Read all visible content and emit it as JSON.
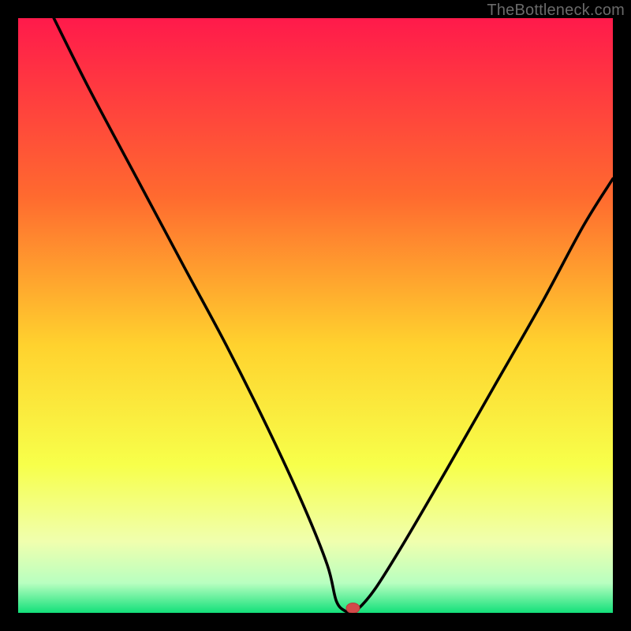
{
  "watermark": "TheBottleneck.com",
  "chart_data": {
    "type": "line",
    "title": "",
    "xlabel": "",
    "ylabel": "",
    "xlim": [
      0,
      100
    ],
    "ylim": [
      0,
      100
    ],
    "x": [
      6,
      12,
      20,
      28,
      35,
      42,
      48,
      52,
      53.5,
      55,
      56,
      57,
      60,
      65,
      72,
      80,
      88,
      95,
      100
    ],
    "values": [
      100,
      88,
      73,
      58,
      45,
      31,
      18,
      8,
      2,
      0.3,
      0.3,
      0.5,
      4,
      12,
      24,
      38,
      52,
      65,
      73
    ],
    "marker": {
      "x": 56.3,
      "y": 0.8,
      "color": "#d24a4a"
    },
    "gradient_stops": [
      {
        "offset": 0,
        "color": "#ff1a4b"
      },
      {
        "offset": 30,
        "color": "#ff6a2f"
      },
      {
        "offset": 55,
        "color": "#ffd22e"
      },
      {
        "offset": 75,
        "color": "#f7ff4a"
      },
      {
        "offset": 88,
        "color": "#f0ffae"
      },
      {
        "offset": 95,
        "color": "#b8ffc0"
      },
      {
        "offset": 100,
        "color": "#13e07a"
      }
    ]
  }
}
